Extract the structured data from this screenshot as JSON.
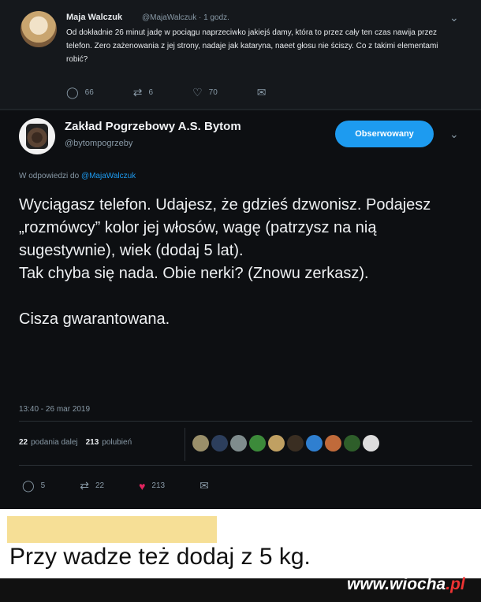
{
  "reply_tweet": {
    "author_name": "Maja Walczuk",
    "handle_time": "@MajaWalczuk · 1 godz.",
    "text": "Od dokładnie 26 minut jadę w pociągu naprzeciwko jakiejś damy, która to przez cały ten czas nawija przez telefon. Zero zażenowania z jej strony, nadaje jak kataryna, naeet głosu nie ściszy. Co z takimi elementami robić?",
    "replies": "66",
    "retweets": "6",
    "likes": "70"
  },
  "main_tweet": {
    "author_name": "Zakład Pogrzebowy A.S. Bytom",
    "handle": "@bytompogrzeby",
    "follow_label": "Obserwowany",
    "in_reply_prefix": "W odpowiedzi do",
    "in_reply_handle": "@MajaWalczuk",
    "paragraph1": "Wyciągasz telefon. Udajesz, że gdzieś dzwonisz. Podajesz „rozmówcy” kolor jej włosów, wagę (patrzysz na nią sugestywnie), wiek (dodaj 5 lat).",
    "paragraph2": "Tak chyba się nada. Obie nerki? (Znowu zerkasz).",
    "paragraph3": "Cisza gwarantowana.",
    "timestamp": "13:40 - 26 mar 2019",
    "retweet_count": "22",
    "retweet_label": "podania dalej",
    "like_count": "213",
    "like_label": "polubień",
    "replies": "5",
    "retweets": "22",
    "likes": "213"
  },
  "caption": "Przy wadze też dodaj z 5 kg.",
  "watermark": {
    "main": "www.wiocha",
    "tld": ".pl"
  },
  "icons": [
    "reply-icon",
    "retweet-icon",
    "heart-icon",
    "mail-icon",
    "chevron-down-icon"
  ],
  "colors": {
    "accent": "#1d9bf0",
    "like": "#e0245e",
    "caption_highlight": "#f6df96"
  }
}
